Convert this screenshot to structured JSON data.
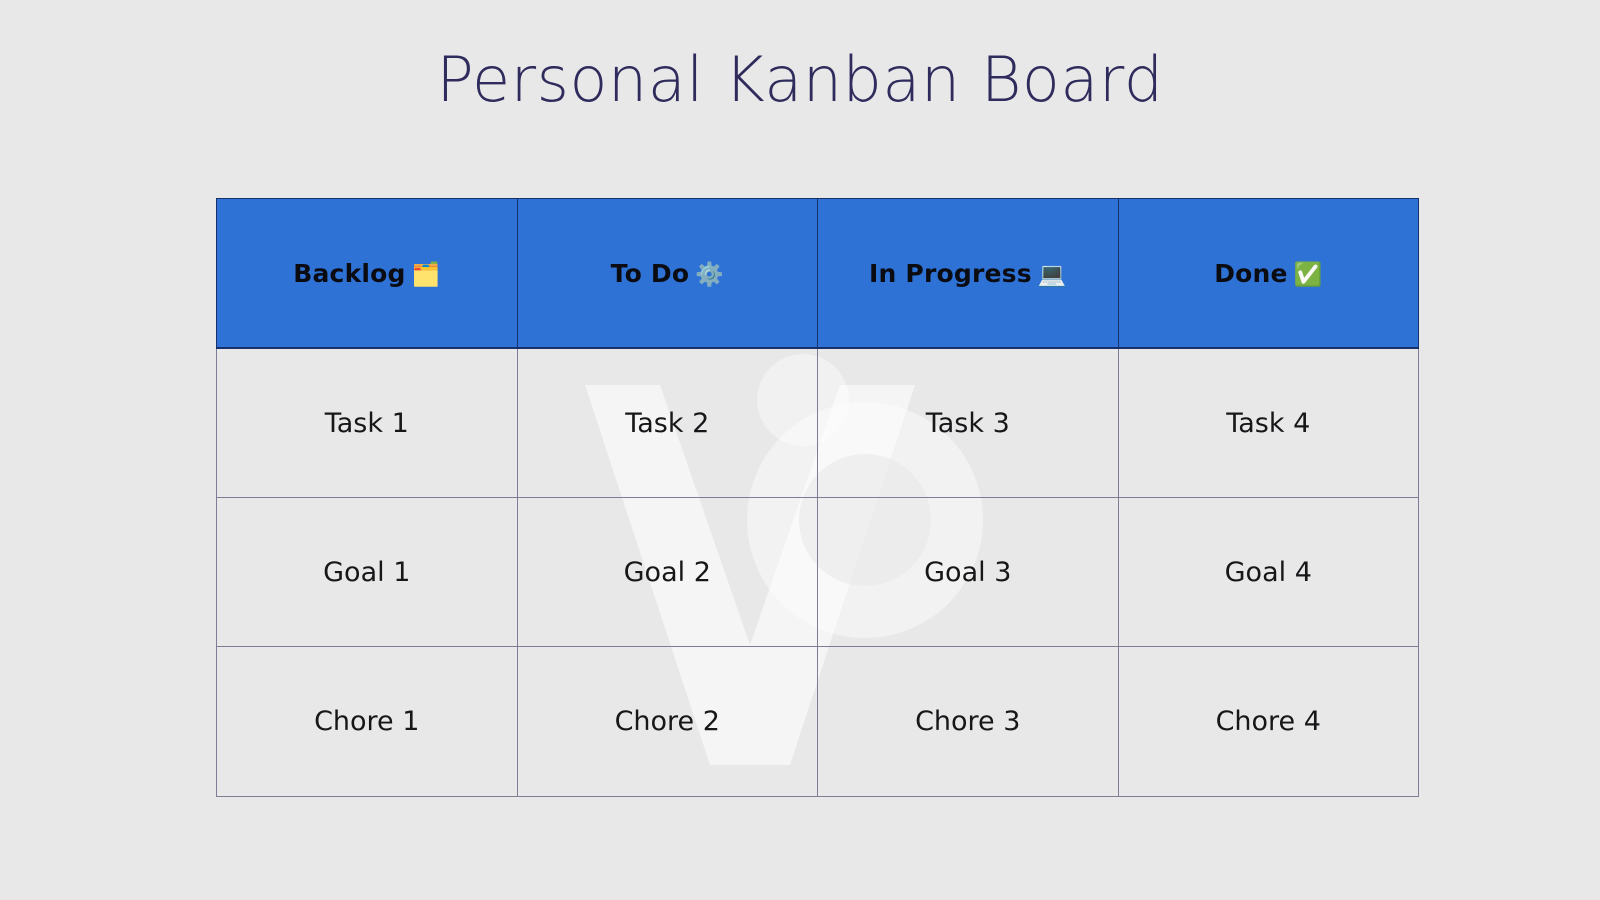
{
  "page": {
    "title": "Personal Kanban Board",
    "background_color": "#e8e8e8",
    "title_color": "#2f2b5c",
    "header_color": "#2e72d6",
    "border_color": "#7d7d97"
  },
  "board": {
    "columns": [
      {
        "label": "Backlog",
        "emoji": "🗂️",
        "icon_name": "card-index-dividers-icon"
      },
      {
        "label": "To Do",
        "emoji": "⚙️",
        "icon_name": "gear-icon"
      },
      {
        "label": "In Progress",
        "emoji": "💻",
        "icon_name": "laptop-icon"
      },
      {
        "label": "Done",
        "emoji": "✅",
        "icon_name": "check-mark-button-icon"
      }
    ],
    "rows": [
      [
        "Task 1",
        "Task 2",
        "Task 3",
        "Task 4"
      ],
      [
        "Goal 1",
        "Goal 2",
        "Goal 3",
        "Goal 4"
      ],
      [
        "Chore 1",
        "Chore 2",
        "Chore 3",
        "Chore 4"
      ]
    ]
  }
}
